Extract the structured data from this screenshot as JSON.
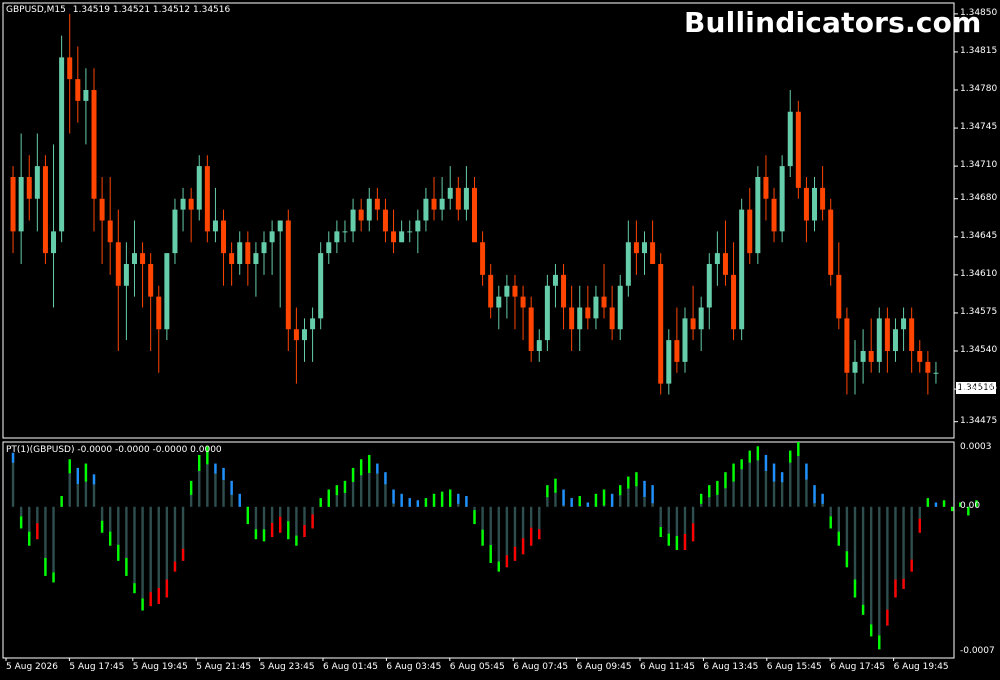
{
  "header": {
    "symbol": "GBPUSD,M15",
    "ohlc": "1.34519 1.34521 1.34512 1.34516",
    "indicator": "PT(1)(GBPUSD) -0.0000 -0.0000 -0.0000 0.0000"
  },
  "brand": "Bullindicators.com",
  "current_price": "1.34516",
  "price_axis": [
    "1.34850",
    "1.34815",
    "1.34780",
    "1.34745",
    "1.34710",
    "1.34680",
    "1.34645",
    "1.34610",
    "1.34575",
    "1.34540",
    "1.34505",
    "1.34475"
  ],
  "indicator_axis": [
    "0.0003",
    "0.00",
    "-0.0007"
  ],
  "time_axis": [
    "5 Aug 2026",
    "5 Aug 17:45",
    "5 Aug 19:45",
    "5 Aug 21:45",
    "5 Aug 23:45",
    "6 Aug 01:45",
    "6 Aug 03:45",
    "6 Aug 05:45",
    "6 Aug 07:45",
    "6 Aug 09:45",
    "6 Aug 11:45",
    "6 Aug 13:45",
    "6 Aug 15:45",
    "6 Aug 17:45",
    "6 Aug 19:45"
  ],
  "colors": {
    "bull": "#66cdaa",
    "bear": "#ff4500",
    "hist_gray": "#2f4f4f",
    "hist_red": "#ff0000",
    "hist_blue": "#1e90ff",
    "hist_green": "#00ff00",
    "frame": "#ffffff"
  },
  "chart_data": {
    "type": "candlestick",
    "symbol": "GBPUSD",
    "timeframe": "M15",
    "y_range": [
      1.3446,
      1.3486
    ],
    "candles": [
      [
        1.347,
        1.3471,
        1.3463,
        1.3465
      ],
      [
        1.3465,
        1.3474,
        1.3462,
        1.347
      ],
      [
        1.347,
        1.3472,
        1.3466,
        1.3468
      ],
      [
        1.3468,
        1.3474,
        1.3465,
        1.3471
      ],
      [
        1.3471,
        1.3472,
        1.3462,
        1.3463
      ],
      [
        1.3463,
        1.3473,
        1.3458,
        1.3465
      ],
      [
        1.3465,
        1.3483,
        1.3464,
        1.3481
      ],
      [
        1.3481,
        1.3485,
        1.3474,
        1.3479
      ],
      [
        1.3479,
        1.3482,
        1.3475,
        1.3477
      ],
      [
        1.3477,
        1.348,
        1.3473,
        1.3478
      ],
      [
        1.3478,
        1.348,
        1.3465,
        1.3468
      ],
      [
        1.3468,
        1.347,
        1.3462,
        1.3466
      ],
      [
        1.3466,
        1.347,
        1.3461,
        1.3464
      ],
      [
        1.3464,
        1.3467,
        1.3454,
        1.346
      ],
      [
        1.346,
        1.3464,
        1.3455,
        1.3462
      ],
      [
        1.3462,
        1.3466,
        1.3459,
        1.3463
      ],
      [
        1.3463,
        1.3464,
        1.3458,
        1.3462
      ],
      [
        1.3462,
        1.3463,
        1.3454,
        1.3459
      ],
      [
        1.3459,
        1.346,
        1.3452,
        1.3456
      ],
      [
        1.3456,
        1.3463,
        1.3455,
        1.3463
      ],
      [
        1.3463,
        1.3468,
        1.3462,
        1.3467
      ],
      [
        1.3467,
        1.3469,
        1.3465,
        1.3468
      ],
      [
        1.3468,
        1.3469,
        1.3464,
        1.3467
      ],
      [
        1.3467,
        1.3472,
        1.3466,
        1.3471
      ],
      [
        1.3471,
        1.3472,
        1.3464,
        1.3465
      ],
      [
        1.3465,
        1.3469,
        1.3464,
        1.3466
      ],
      [
        1.3466,
        1.3467,
        1.346,
        1.3463
      ],
      [
        1.3463,
        1.3464,
        1.346,
        1.3462
      ],
      [
        1.3462,
        1.3465,
        1.3461,
        1.3464
      ],
      [
        1.3464,
        1.3465,
        1.346,
        1.3462
      ],
      [
        1.3462,
        1.3464,
        1.3459,
        1.3463
      ],
      [
        1.3463,
        1.3465,
        1.3461,
        1.3464
      ],
      [
        1.3464,
        1.3466,
        1.3461,
        1.3465
      ],
      [
        1.3465,
        1.3466,
        1.3458,
        1.3466
      ],
      [
        1.3466,
        1.3467,
        1.3454,
        1.3456
      ],
      [
        1.3456,
        1.3458,
        1.3451,
        1.3455
      ],
      [
        1.3455,
        1.3457,
        1.3453,
        1.3456
      ],
      [
        1.3456,
        1.3458,
        1.3453,
        1.3457
      ],
      [
        1.3457,
        1.3464,
        1.3456,
        1.3463
      ],
      [
        1.3463,
        1.3465,
        1.3462,
        1.3464
      ],
      [
        1.3464,
        1.3466,
        1.3463,
        1.3465
      ],
      [
        1.3465,
        1.3466,
        1.3464,
        1.3465
      ],
      [
        1.3465,
        1.3468,
        1.3464,
        1.3467
      ],
      [
        1.3467,
        1.3468,
        1.3465,
        1.3466
      ],
      [
        1.3466,
        1.3469,
        1.3465,
        1.3468
      ],
      [
        1.3468,
        1.3469,
        1.3466,
        1.3467
      ],
      [
        1.3467,
        1.3468,
        1.3464,
        1.3465
      ],
      [
        1.3465,
        1.3467,
        1.3463,
        1.3464
      ],
      [
        1.3464,
        1.3466,
        1.3464,
        1.3465
      ],
      [
        1.3465,
        1.3466,
        1.3464,
        1.3465
      ],
      [
        1.3465,
        1.3467,
        1.3463,
        1.3466
      ],
      [
        1.3466,
        1.3469,
        1.3465,
        1.3468
      ],
      [
        1.3468,
        1.347,
        1.3466,
        1.3467
      ],
      [
        1.3467,
        1.347,
        1.3466,
        1.3468
      ],
      [
        1.3468,
        1.3471,
        1.3467,
        1.3469
      ],
      [
        1.3469,
        1.347,
        1.3466,
        1.3467
      ],
      [
        1.3467,
        1.3471,
        1.3466,
        1.3469
      ],
      [
        1.3469,
        1.347,
        1.3466,
        1.3464
      ],
      [
        1.3464,
        1.3465,
        1.346,
        1.3461
      ],
      [
        1.3461,
        1.3462,
        1.3457,
        1.3458
      ],
      [
        1.3458,
        1.346,
        1.3456,
        1.3459
      ],
      [
        1.3459,
        1.3461,
        1.3457,
        1.346
      ],
      [
        1.346,
        1.3461,
        1.3456,
        1.3459
      ],
      [
        1.3459,
        1.346,
        1.3455,
        1.3458
      ],
      [
        1.3458,
        1.3459,
        1.3453,
        1.3454
      ],
      [
        1.3454,
        1.3456,
        1.3453,
        1.3455
      ],
      [
        1.3455,
        1.3461,
        1.3454,
        1.346
      ],
      [
        1.346,
        1.3462,
        1.3458,
        1.3461
      ],
      [
        1.3461,
        1.3462,
        1.3456,
        1.3458
      ],
      [
        1.3458,
        1.346,
        1.3454,
        1.3456
      ],
      [
        1.3456,
        1.346,
        1.3454,
        1.3458
      ],
      [
        1.3458,
        1.346,
        1.3456,
        1.3457
      ],
      [
        1.3457,
        1.346,
        1.3456,
        1.3459
      ],
      [
        1.3459,
        1.3462,
        1.3457,
        1.3458
      ],
      [
        1.3458,
        1.346,
        1.3455,
        1.3456
      ],
      [
        1.3456,
        1.3461,
        1.3455,
        1.346
      ],
      [
        1.346,
        1.3466,
        1.3459,
        1.3464
      ],
      [
        1.3464,
        1.3466,
        1.3461,
        1.3463
      ],
      [
        1.3463,
        1.3465,
        1.3461,
        1.3464
      ],
      [
        1.3464,
        1.3466,
        1.3462,
        1.3462
      ],
      [
        1.3462,
        1.3463,
        1.345,
        1.3451
      ],
      [
        1.3451,
        1.3456,
        1.345,
        1.3455
      ],
      [
        1.3455,
        1.3458,
        1.3452,
        1.3453
      ],
      [
        1.3453,
        1.3458,
        1.3452,
        1.3457
      ],
      [
        1.3457,
        1.346,
        1.3455,
        1.3456
      ],
      [
        1.3456,
        1.3459,
        1.3454,
        1.3458
      ],
      [
        1.3458,
        1.3463,
        1.3456,
        1.3462
      ],
      [
        1.3462,
        1.3465,
        1.346,
        1.3463
      ],
      [
        1.3463,
        1.3466,
        1.346,
        1.3461
      ],
      [
        1.3461,
        1.3464,
        1.3455,
        1.3456
      ],
      [
        1.3456,
        1.3468,
        1.3455,
        1.3467
      ],
      [
        1.3467,
        1.3469,
        1.3462,
        1.3463
      ],
      [
        1.3463,
        1.3471,
        1.3462,
        1.347
      ],
      [
        1.347,
        1.3472,
        1.3466,
        1.3468
      ],
      [
        1.3468,
        1.3469,
        1.3464,
        1.3465
      ],
      [
        1.3465,
        1.3472,
        1.3464,
        1.3471
      ],
      [
        1.3471,
        1.3478,
        1.347,
        1.3476
      ],
      [
        1.3476,
        1.3477,
        1.3468,
        1.3469
      ],
      [
        1.3469,
        1.347,
        1.3464,
        1.3466
      ],
      [
        1.3466,
        1.347,
        1.3465,
        1.3469
      ],
      [
        1.3469,
        1.3471,
        1.3466,
        1.3467
      ],
      [
        1.3467,
        1.3468,
        1.346,
        1.3461
      ],
      [
        1.3461,
        1.3464,
        1.3456,
        1.3457
      ],
      [
        1.3457,
        1.3458,
        1.345,
        1.3452
      ],
      [
        1.3452,
        1.3455,
        1.345,
        1.3453
      ],
      [
        1.3453,
        1.3456,
        1.3451,
        1.3454
      ],
      [
        1.3454,
        1.3457,
        1.3452,
        1.3453
      ],
      [
        1.3453,
        1.3458,
        1.3452,
        1.3457
      ],
      [
        1.3457,
        1.3458,
        1.3452,
        1.3454
      ],
      [
        1.3454,
        1.3457,
        1.3453,
        1.3456
      ],
      [
        1.3456,
        1.3458,
        1.3454,
        1.3457
      ],
      [
        1.3457,
        1.3458,
        1.3452,
        1.3454
      ],
      [
        1.3454,
        1.3455,
        1.3452,
        1.3453
      ],
      [
        1.3453,
        1.3454,
        1.345,
        1.3452
      ],
      [
        1.3452,
        1.3453,
        1.3451,
        1.3452
      ]
    ],
    "indicator": {
      "name": "PT(1)(GBPUSD)",
      "y_range": [
        -0.0007,
        0.0003
      ],
      "values": [
        0.00025,
        -0.0001,
        -0.00018,
        -0.00015,
        -0.00032,
        -0.00035,
        5e-05,
        0.00022,
        0.00018,
        0.0002,
        0.00015,
        -0.00012,
        -0.00018,
        -0.00025,
        -0.00032,
        -0.0004,
        -0.00048,
        -0.00046,
        -0.00045,
        -0.00042,
        -0.0003,
        -0.00025,
        0.00012,
        0.00024,
        0.00028,
        0.0002,
        0.00018,
        0.00012,
        6e-05,
        -8e-05,
        -0.00015,
        -0.00016,
        -0.00014,
        -0.00012,
        -0.00015,
        -0.00018,
        -0.00014,
        -0.0001,
        4e-05,
        8e-05,
        0.0001,
        0.00012,
        0.00018,
        0.00022,
        0.00024,
        0.0002,
        0.00016,
        8e-05,
        6e-05,
        4e-05,
        3e-05,
        4e-05,
        6e-05,
        7e-05,
        8e-05,
        6e-05,
        5e-05,
        -8e-05,
        -0.00018,
        -0.00026,
        -0.0003,
        -0.00028,
        -0.00025,
        -0.00022,
        -0.00018,
        -0.00015,
        0.0001,
        0.00013,
        8e-05,
        4e-05,
        5e-05,
        2e-05,
        6e-05,
        8e-05,
        6e-05,
        0.0001,
        0.00014,
        0.00016,
        0.00012,
        0.0001,
        -0.00014,
        -0.00018,
        -0.0002,
        -0.0002,
        -0.00016,
        6e-05,
        0.0001,
        0.00012,
        0.00016,
        0.0002,
        0.00022,
        0.00026,
        0.00028,
        0.00024,
        0.0002,
        0.00016,
        0.00026,
        0.0003,
        0.0002,
        0.0001,
        6e-05,
        -0.0001,
        -0.00018,
        -0.00028,
        -0.00042,
        -0.0005,
        -0.0006,
        -0.00066,
        -0.00055,
        -0.00042,
        -0.00038,
        -0.0003,
        -0.00012,
        4e-05,
        2e-05,
        3e-05,
        -2e-05,
        2e-05,
        -4e-05,
        3e-05
      ]
    },
    "x_labels": [
      "5 Aug 2026",
      "5 Aug 17:45",
      "5 Aug 19:45",
      "5 Aug 21:45",
      "5 Aug 23:45",
      "6 Aug 01:45",
      "6 Aug 03:45",
      "6 Aug 05:45",
      "6 Aug 07:45",
      "6 Aug 09:45",
      "6 Aug 11:45",
      "6 Aug 13:45",
      "6 Aug 15:45",
      "6 Aug 17:45",
      "6 Aug 19:45"
    ],
    "price_ticks": [
      1.3485,
      1.34815,
      1.3478,
      1.34745,
      1.3471,
      1.3468,
      1.34645,
      1.3461,
      1.34575,
      1.3454,
      1.34505,
      1.34475
    ],
    "indicator_ticks": [
      0.0003,
      0.0,
      -0.0007
    ]
  }
}
